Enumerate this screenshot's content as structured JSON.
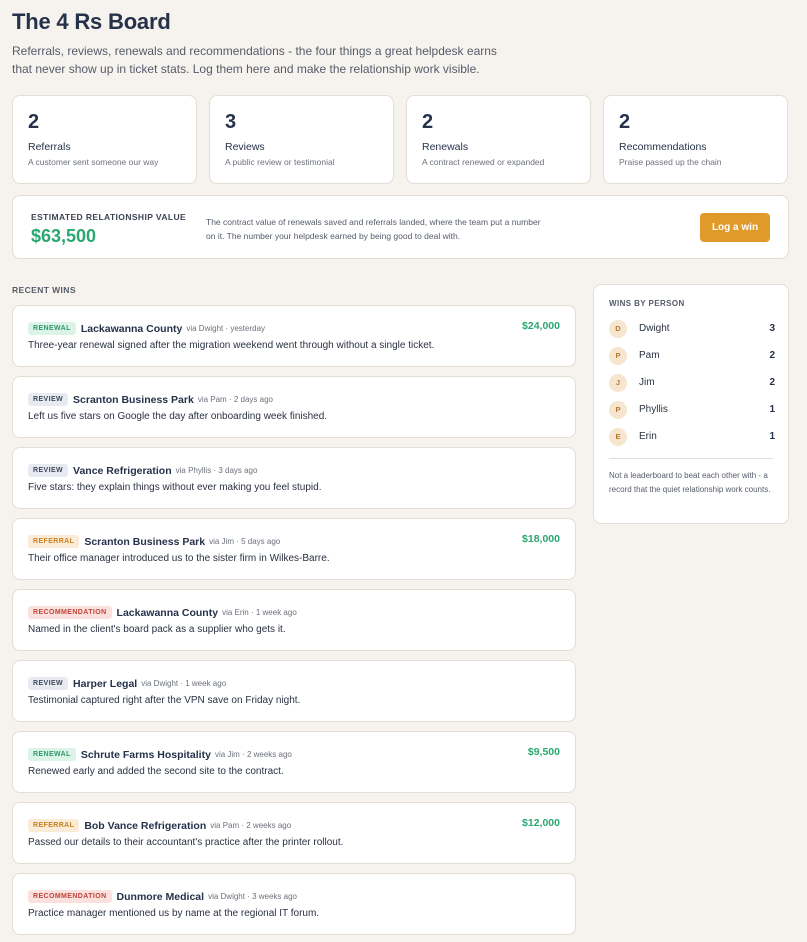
{
  "header": {
    "title": "The 4 Rs Board",
    "intro": "Referrals, reviews, renewals and recommendations - the four things a great helpdesk earns that never show up in ticket stats. Log them here and make the relationship work visible."
  },
  "stats": [
    {
      "count": "2",
      "label": "Referrals",
      "desc": "A customer sent someone our way"
    },
    {
      "count": "3",
      "label": "Reviews",
      "desc": "A public review or testimonial"
    },
    {
      "count": "2",
      "label": "Renewals",
      "desc": "A contract renewed or expanded"
    },
    {
      "count": "2",
      "label": "Recommendations",
      "desc": "Praise passed up the chain"
    }
  ],
  "value": {
    "label": "ESTIMATED RELATIONSHIP VALUE",
    "amount": "$63,500",
    "desc": "The contract value of renewals saved and referrals landed, where the team put a number on it. The number your helpdesk earned by being good to deal with.",
    "button": "Log a win"
  },
  "recent": {
    "label": "RECENT WINS",
    "items": [
      {
        "type": "renewal",
        "badge": "RENEWAL",
        "client": "Lackawanna County",
        "meta": "via Dwight · yesterday",
        "amount": "$24,000",
        "text": "Three-year renewal signed after the migration weekend went through without a single ticket."
      },
      {
        "type": "review",
        "badge": "REVIEW",
        "client": "Scranton Business Park",
        "meta": "via Pam · 2 days ago",
        "amount": "",
        "text": "Left us five stars on Google the day after onboarding week finished."
      },
      {
        "type": "review",
        "badge": "REVIEW",
        "client": "Vance Refrigeration",
        "meta": "via Phyllis · 3 days ago",
        "amount": "",
        "text": "Five stars: they explain things without ever making you feel stupid."
      },
      {
        "type": "referral",
        "badge": "REFERRAL",
        "client": "Scranton Business Park",
        "meta": "via Jim · 5 days ago",
        "amount": "$18,000",
        "text": "Their office manager introduced us to the sister firm in Wilkes-Barre."
      },
      {
        "type": "recommendation",
        "badge": "RECOMMENDATION",
        "client": "Lackawanna County",
        "meta": "via Erin · 1 week ago",
        "amount": "",
        "text": "Named in the client's board pack as a supplier who gets it."
      },
      {
        "type": "review",
        "badge": "REVIEW",
        "client": "Harper Legal",
        "meta": "via Dwight · 1 week ago",
        "amount": "",
        "text": "Testimonial captured right after the VPN save on Friday night."
      },
      {
        "type": "renewal",
        "badge": "RENEWAL",
        "client": "Schrute Farms Hospitality",
        "meta": "via Jim · 2 weeks ago",
        "amount": "$9,500",
        "text": "Renewed early and added the second site to the contract."
      },
      {
        "type": "referral",
        "badge": "REFERRAL",
        "client": "Bob Vance Refrigeration",
        "meta": "via Pam · 2 weeks ago",
        "amount": "$12,000",
        "text": "Passed our details to their accountant's practice after the printer rollout."
      },
      {
        "type": "recommendation",
        "badge": "RECOMMENDATION",
        "client": "Dunmore Medical",
        "meta": "via Dwight · 3 weeks ago",
        "amount": "",
        "text": "Practice manager mentioned us by name at the regional IT forum."
      }
    ]
  },
  "people": {
    "title": "WINS BY PERSON",
    "items": [
      {
        "initial": "D",
        "name": "Dwight",
        "count": "3"
      },
      {
        "initial": "P",
        "name": "Pam",
        "count": "2"
      },
      {
        "initial": "J",
        "name": "Jim",
        "count": "2"
      },
      {
        "initial": "P",
        "name": "Phyllis",
        "count": "1"
      },
      {
        "initial": "E",
        "name": "Erin",
        "count": "1"
      }
    ],
    "note": "Not a leaderboard to beat each other with - a record that the quiet relationship work counts."
  }
}
